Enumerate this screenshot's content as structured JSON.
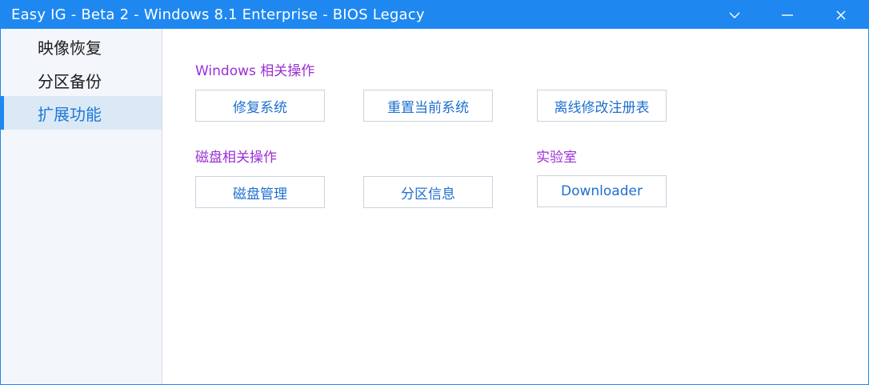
{
  "window": {
    "title": "Easy IG - Beta 2 - Windows 8.1 Enterprise - BIOS Legacy",
    "accent_color": "#1e88f0",
    "controls": [
      "chevron-down-icon",
      "minimize-icon",
      "close-icon"
    ]
  },
  "sidebar": {
    "items": [
      {
        "label": "映像恢复",
        "active": false
      },
      {
        "label": "分区备份",
        "active": false
      },
      {
        "label": "扩展功能",
        "active": true
      }
    ]
  },
  "main": {
    "sections": [
      {
        "title": "Windows 相关操作",
        "buttons": [
          "修复系统",
          "重置当前系统",
          "离线修改注册表"
        ]
      },
      {
        "title": "磁盘相关操作",
        "buttons": [
          "磁盘管理",
          "分区信息"
        ]
      },
      {
        "title": "实验室",
        "buttons": [
          "Downloader"
        ]
      }
    ],
    "section_title_color": "#9b2fd6",
    "button_text_color": "#1e6fd0"
  }
}
